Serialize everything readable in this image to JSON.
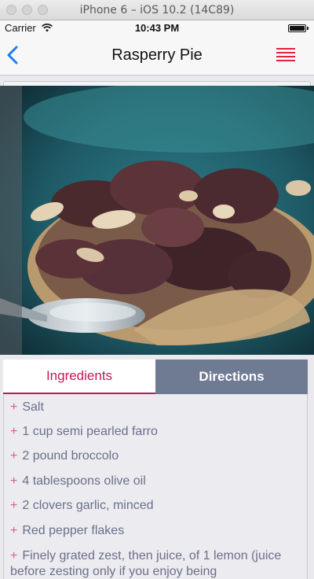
{
  "simulator": {
    "title": "iPhone 6 – iOS 10.2 (14C89)"
  },
  "status_bar": {
    "carrier": "Carrier",
    "time": "10:43 PM"
  },
  "navbar": {
    "title": "Rasperry Pie",
    "accent_color": "#e0243d",
    "back_color": "#1e7cf2"
  },
  "tabs": [
    {
      "label": "Ingredients",
      "active": true
    },
    {
      "label": "Directions",
      "active": false
    }
  ],
  "ingredients": {
    "bullet": "+",
    "items": [
      "Salt",
      "1 cup semi pearled farro",
      "2 pound broccolo",
      "4 tablespoons olive oil",
      "2 clovers garlic, minced",
      "Red pepper flakes",
      "Finely grated zest, then juice, of 1 lemon (juice before zesting only if you enjoy being"
    ]
  },
  "colors": {
    "active_tab_text": "#c2185b",
    "inactive_tab_bg": "#6f7a93",
    "ingredient_text": "#6b7089",
    "bullet": "#d2667f"
  }
}
